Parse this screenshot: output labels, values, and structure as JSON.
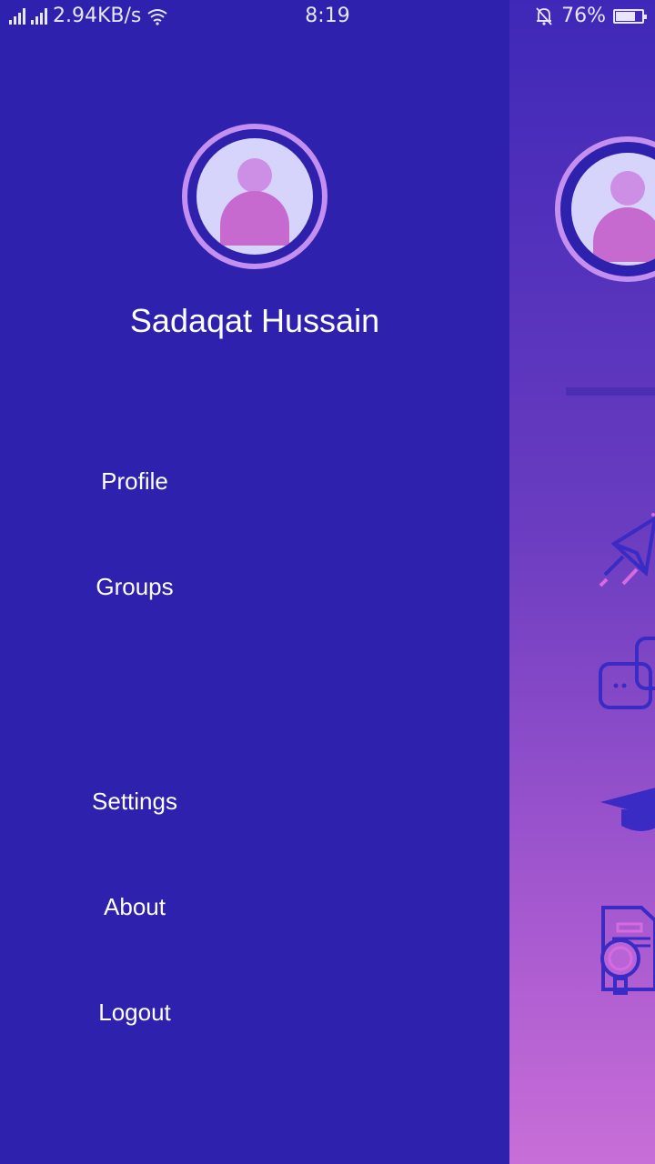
{
  "status_bar": {
    "network_speed": "2.94KB/s",
    "time": "8:19",
    "battery_percent": "76%",
    "battery_level": 0.76,
    "icons": [
      "signal-icon",
      "signal-icon",
      "wifi-icon",
      "bell-muted-icon",
      "battery-icon"
    ]
  },
  "drawer": {
    "user_name": "Sadaqat Hussain",
    "menu": {
      "profile": "Profile",
      "groups": "Groups",
      "settings": "Settings",
      "about": "About",
      "logout": "Logout"
    }
  },
  "colors": {
    "drawer_bg": "#2e21ad",
    "avatar_ring": "#c58ff0",
    "avatar_bg": "#d6d4fb",
    "person": "#c76ad0",
    "gradient_bottom": "#c86ed8"
  },
  "background_icons": [
    "paper-plane-icon",
    "chat-bubbles-icon",
    "graduation-cap-icon",
    "document-search-icon"
  ]
}
